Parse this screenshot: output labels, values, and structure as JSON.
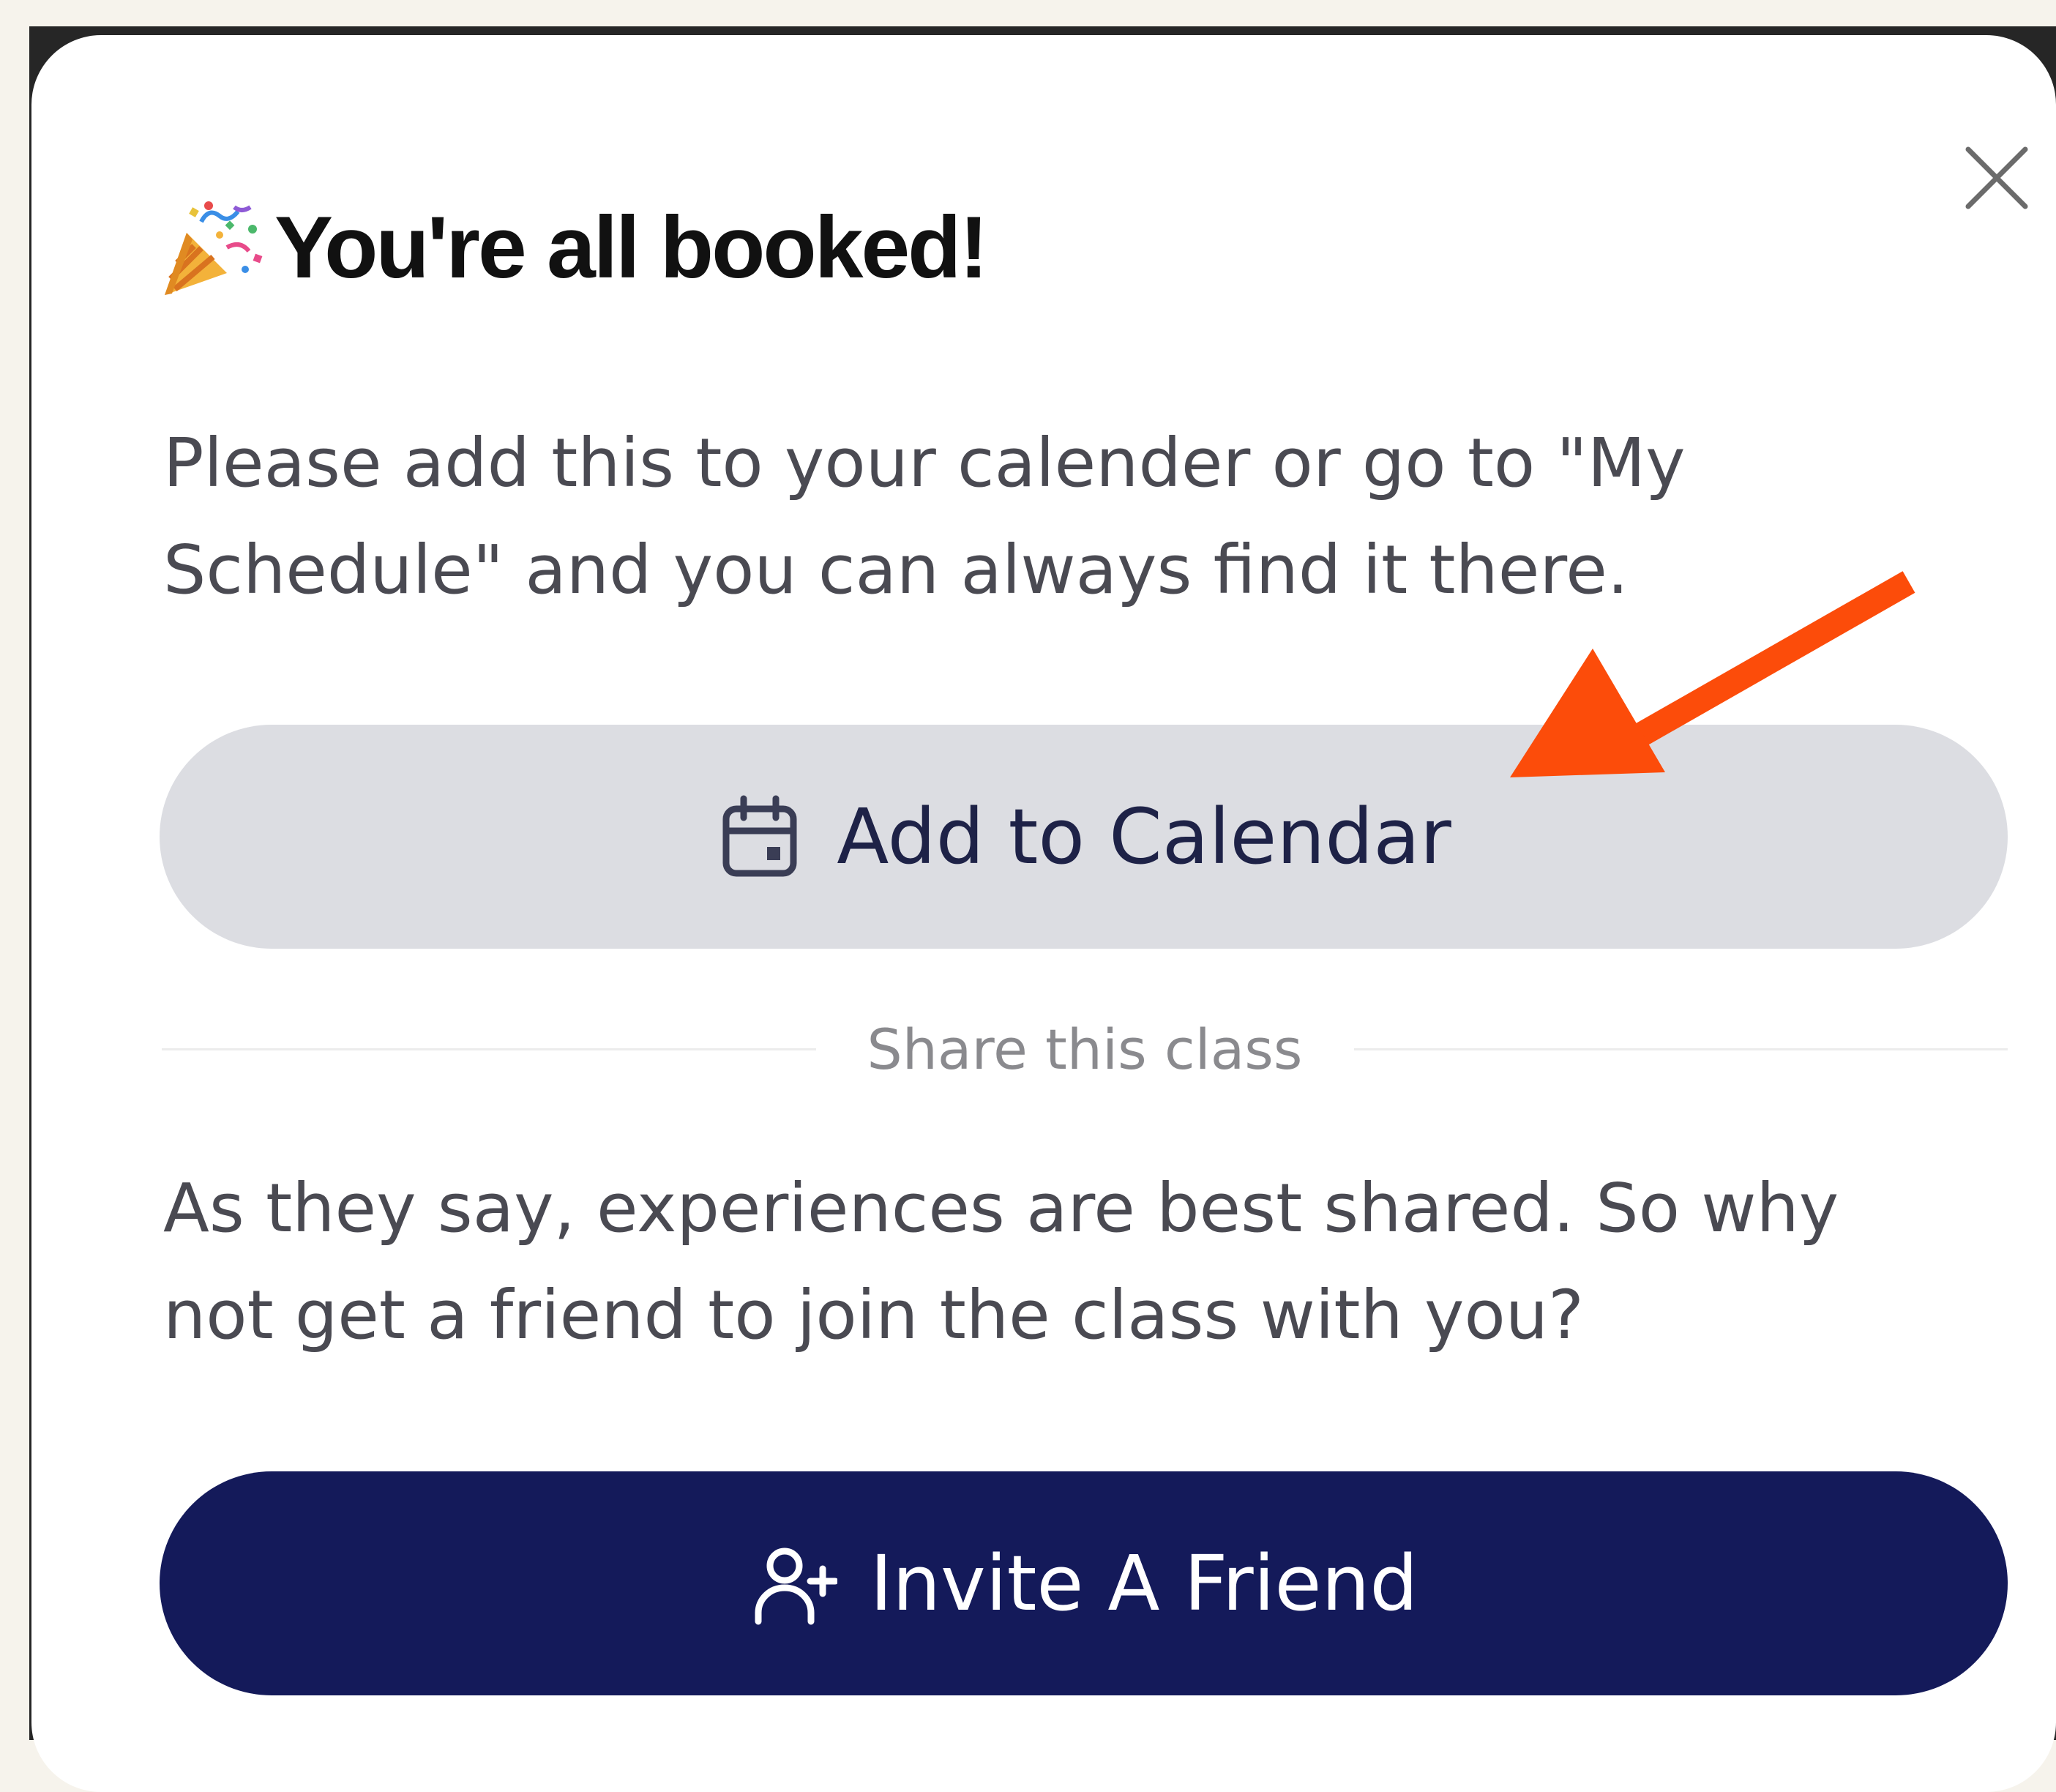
{
  "modal": {
    "title": "You're all booked!",
    "intro_text": "Please add this to your calender or go to \"My Schedule\" and you can always find it there.",
    "add_to_calendar_label": "Add to Calendar",
    "share_divider_label": "Share this class",
    "share_text": "As they say, experiences are best shared. So why not get a friend to join the class with you?",
    "invite_friend_label": "Invite A Friend"
  },
  "icons": {
    "title": "party-popper-icon",
    "close": "close-icon",
    "calendar": "calendar-icon",
    "invite": "user-plus-icon",
    "annotation": "arrow-annotation"
  },
  "colors": {
    "primary_button": "#141a5a",
    "secondary_button": "#dcdde2",
    "annotation_arrow": "#fc4c0a"
  }
}
